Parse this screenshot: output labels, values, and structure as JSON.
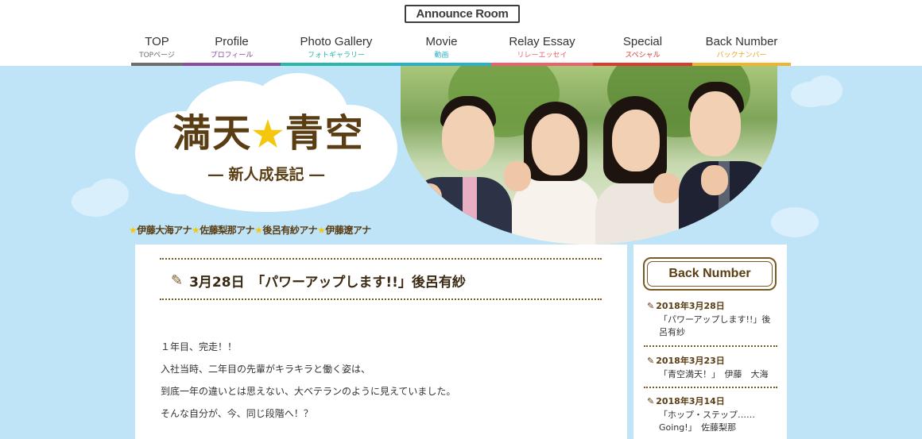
{
  "header": {
    "logo": "Announce Room",
    "nav": [
      {
        "en": "TOP",
        "ja": "TOPページ",
        "color": "#6e6e6e"
      },
      {
        "en": "Profile",
        "ja": "プロフィール",
        "color": "#8a4d9b"
      },
      {
        "en": "Photo Gallery",
        "ja": "フォトギャラリー",
        "color": "#2bb8a6"
      },
      {
        "en": "Movie",
        "ja": "動画",
        "color": "#2bb0c8"
      },
      {
        "en": "Relay Essay",
        "ja": "リレーエッセイ",
        "color": "#e8636b"
      },
      {
        "en": "Special",
        "ja": "スペシャル",
        "color": "#d93a32"
      },
      {
        "en": "Back Number",
        "ja": "バックナンバー",
        "color": "#f0b432"
      }
    ]
  },
  "banner": {
    "title_left": "満天",
    "title_star": "★",
    "title_right": "青空",
    "subtitle": "― 新人成長記 ―",
    "announcers": [
      {
        "star": "★",
        "name": "伊藤大海アナ"
      },
      {
        "star": "★",
        "name": "佐藤梨那アナ"
      },
      {
        "star": "★",
        "name": "後呂有紗アナ"
      },
      {
        "star": "★",
        "name": "伊藤遼アナ"
      }
    ]
  },
  "article": {
    "title": "3月28日　「パワーアップします!!」後呂有紗",
    "paragraphs": [
      "１年目、完走！！",
      "入社当時、二年目の先輩がキラキラと働く姿は、",
      "到底一年の違いとは思えない、大ベテランのように見えていました。",
      "そんな自分が、今、同じ段階へ！？"
    ]
  },
  "sidebar": {
    "heading": "Back Number",
    "items": [
      {
        "date": "2018年3月28日",
        "title": "「パワーアップします!!」後呂有紗"
      },
      {
        "date": "2018年3月23日",
        "title": "「青空満天！」　伊藤　大海"
      },
      {
        "date": "2018年3月14日",
        "title": "「ホップ・ステップ……Going!」　佐藤梨那"
      }
    ]
  }
}
